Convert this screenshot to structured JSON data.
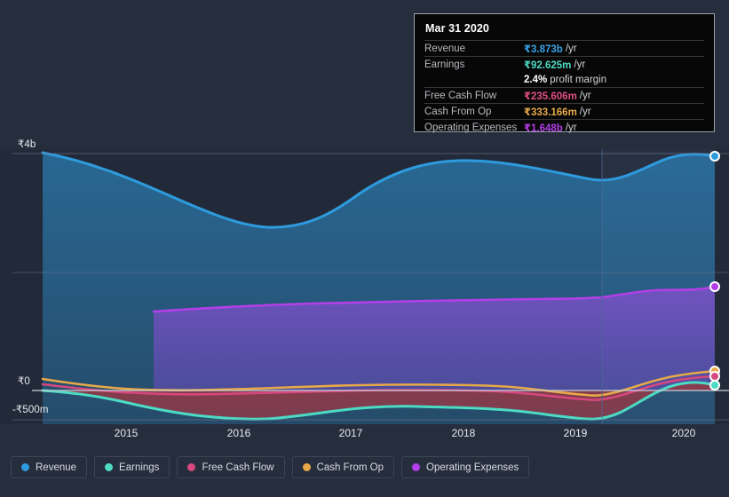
{
  "tooltip": {
    "title": "Mar 31 2020",
    "rows": [
      {
        "key": "Revenue",
        "value": "₹3.873b",
        "suffix": "/yr",
        "color": "#3aa3e8"
      },
      {
        "key": "Earnings",
        "value": "₹92.625m",
        "suffix": "/yr",
        "color": "#4cdbc4"
      },
      {
        "key": "",
        "value": "2.4%",
        "suffix": "profit margin",
        "color": "#ffffff",
        "margin": true
      },
      {
        "key": "Free Cash Flow",
        "value": "₹235.606m",
        "suffix": "/yr",
        "color": "#e04e86"
      },
      {
        "key": "Cash From Op",
        "value": "₹333.166m",
        "suffix": "/yr",
        "color": "#e8a949"
      },
      {
        "key": "Operating Expenses",
        "value": "₹1.648b",
        "suffix": "/yr",
        "color": "#b33fe8"
      }
    ]
  },
  "legend": [
    {
      "label": "Revenue",
      "color": "#2e9bde"
    },
    {
      "label": "Earnings",
      "color": "#4cdbc4"
    },
    {
      "label": "Free Cash Flow",
      "color": "#d6487e"
    },
    {
      "label": "Cash From Op",
      "color": "#e8a949"
    },
    {
      "label": "Operating Expenses",
      "color": "#b33fe8"
    }
  ],
  "chart_data": {
    "type": "area",
    "title": "",
    "xlabel": "",
    "ylabel": "",
    "currency": "₹",
    "x_tick_labels": [
      "2015",
      "2016",
      "2017",
      "2018",
      "2019",
      "2020"
    ],
    "y_tick_labels": [
      "₹4b",
      "₹0",
      "-₹500m"
    ],
    "ylim": [
      -500000000,
      4000000000
    ],
    "grid": true,
    "legend_position": "bottom-left",
    "forecast_divider_label": "2019",
    "series": [
      {
        "name": "Revenue",
        "color": "#2e9bde",
        "x": [
          "2014.6",
          "2015",
          "2016",
          "2017",
          "2018",
          "2019",
          "2019.5",
          "2020",
          "2020.2"
        ],
        "values": [
          3.9,
          3.72,
          3.26,
          3.12,
          3.55,
          3.52,
          3.5,
          3.9,
          3.873
        ],
        "unit": "b"
      },
      {
        "name": "Earnings",
        "color": "#4cdbc4",
        "x": [
          "2014.6",
          "2015",
          "2016",
          "2017",
          "2018",
          "2019",
          "2019.5",
          "2020",
          "2020.2"
        ],
        "values": [
          -0.02,
          -0.28,
          -0.49,
          -0.5,
          -0.06,
          -0.05,
          -0.22,
          0.06,
          0.0926
        ],
        "unit": "b"
      },
      {
        "name": "Free Cash Flow",
        "color": "#d6487e",
        "x": [
          "2014.6",
          "2015",
          "2016",
          "2017",
          "2018",
          "2019",
          "2019.5",
          "2020",
          "2020.2"
        ],
        "values": [
          0.09,
          0.01,
          -0.05,
          -0.04,
          0.01,
          0.0,
          -0.06,
          0.16,
          0.2356
        ],
        "unit": "b"
      },
      {
        "name": "Cash From Op",
        "color": "#e8a949",
        "x": [
          "2014.6",
          "2015",
          "2016",
          "2017",
          "2018",
          "2019",
          "2019.5",
          "2020",
          "2020.2"
        ],
        "values": [
          0.19,
          0.09,
          0.01,
          0.02,
          0.07,
          0.06,
          -0.01,
          0.25,
          0.3332
        ],
        "unit": "b"
      },
      {
        "name": "Operating Expenses",
        "color": "#b33fe8",
        "x": [
          "2015.4",
          "2016",
          "2017",
          "2018",
          "2019",
          "2019.5",
          "2020",
          "2020.2"
        ],
        "values": [
          1.33,
          1.4,
          1.46,
          1.5,
          1.52,
          1.6,
          1.58,
          1.648
        ],
        "unit": "b"
      }
    ]
  }
}
